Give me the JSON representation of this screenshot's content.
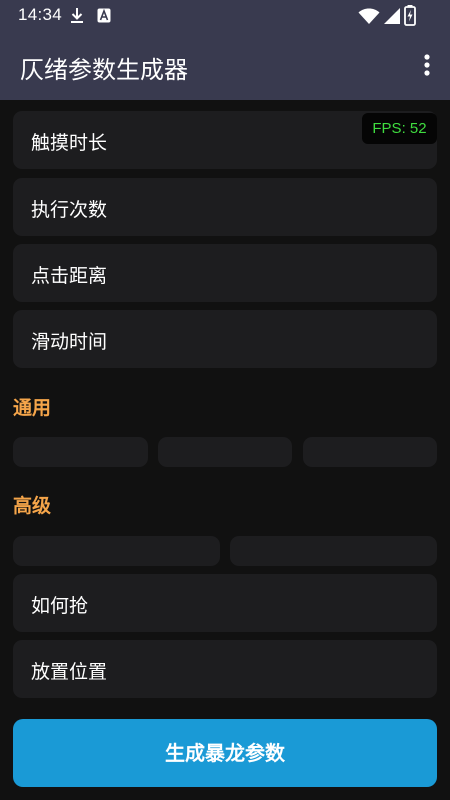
{
  "status_bar": {
    "time": "14:34",
    "icons": [
      "download-icon",
      "accessibility-a-icon",
      "wifi-icon",
      "signal-icon",
      "battery-charging-icon"
    ]
  },
  "app_bar": {
    "title": "仄绪参数生成器",
    "menu_icon": "more-vert-icon"
  },
  "fps_badge": {
    "text": "FPS: 52",
    "color": "#3fdc3f"
  },
  "cards_top": [
    {
      "label": "触摸时长"
    },
    {
      "label": "执行次数"
    },
    {
      "label": "点击距离"
    },
    {
      "label": "滑动时间"
    }
  ],
  "sections": {
    "general": {
      "title": "通用"
    },
    "advanced": {
      "title": "高级"
    }
  },
  "cards_advanced": [
    {
      "label": "如何抢"
    },
    {
      "label": "放置位置"
    }
  ],
  "primary_button": {
    "label": "生成暴龙参数"
  },
  "colors": {
    "app_bar": "#393a4f",
    "background": "#111111",
    "card": "#1d1d1f",
    "section_title": "#f5a54a",
    "primary": "#1a9ad6"
  }
}
